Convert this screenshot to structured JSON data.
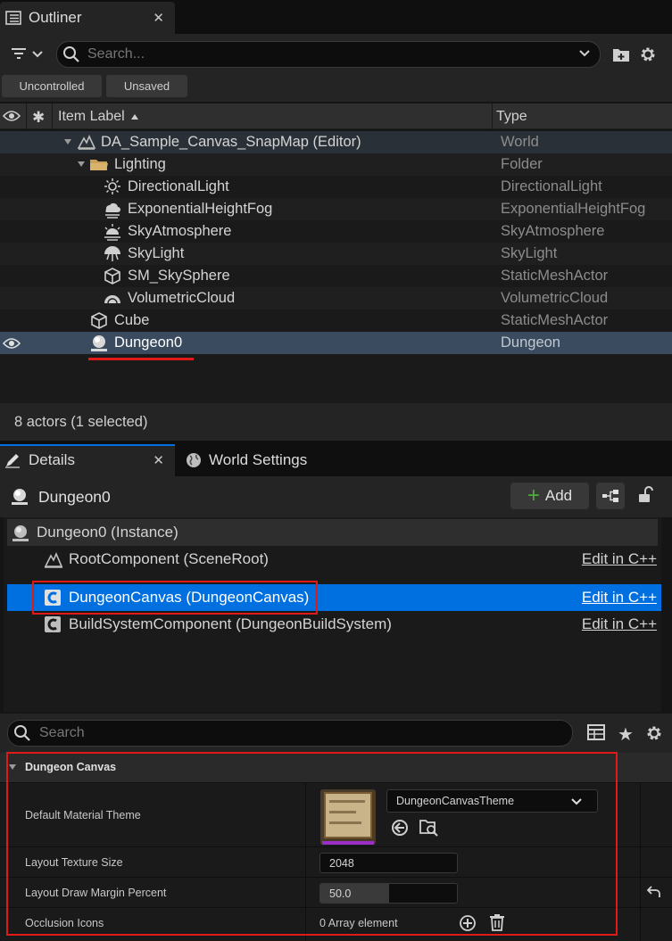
{
  "outliner": {
    "tab_title": "Outliner",
    "search_placeholder": "Search...",
    "filters": [
      "Uncontrolled",
      "Unsaved"
    ],
    "columns": {
      "label": "Item Label",
      "type": "Type"
    },
    "rows": [
      {
        "label": "DA_Sample_Canvas_SnapMap (Editor)",
        "type": "World",
        "icon": "world-icon"
      },
      {
        "label": "Lighting",
        "type": "Folder",
        "icon": "folder-icon"
      },
      {
        "label": "DirectionalLight",
        "type": "DirectionalLight",
        "icon": "sun-icon"
      },
      {
        "label": "ExponentialHeightFog",
        "type": "ExponentialHeightFog",
        "icon": "fog-icon"
      },
      {
        "label": "SkyAtmosphere",
        "type": "SkyAtmosphere",
        "icon": "atmosphere-icon"
      },
      {
        "label": "SkyLight",
        "type": "SkyLight",
        "icon": "skylight-icon"
      },
      {
        "label": "SM_SkySphere",
        "type": "StaticMeshActor",
        "icon": "static-mesh-icon"
      },
      {
        "label": "VolumetricCloud",
        "type": "VolumetricCloud",
        "icon": "cloud-icon"
      },
      {
        "label": "Cube",
        "type": "StaticMeshActor",
        "icon": "static-mesh-icon"
      },
      {
        "label": "Dungeon0",
        "type": "Dungeon",
        "icon": "dungeon-actor-icon"
      }
    ],
    "status": "8 actors (1 selected)"
  },
  "details": {
    "tab_title": "Details",
    "world_settings_tab": "World Settings",
    "actor_name": "Dungeon0",
    "add_label": "Add",
    "components": [
      {
        "label": "Dungeon0 (Instance)",
        "edit": ""
      },
      {
        "label": "RootComponent (SceneRoot)",
        "edit": "Edit in C++"
      },
      {
        "label": "DungeonCanvas (DungeonCanvas)",
        "edit": "Edit in C++"
      },
      {
        "label": "BuildSystemComponent (DungeonBuildSystem)",
        "edit": "Edit in C++"
      }
    ],
    "search_placeholder": "Search",
    "category": "Dungeon Canvas",
    "properties": {
      "material_theme_label": "Default Material Theme",
      "material_theme_value": "DungeonCanvasTheme",
      "texture_size_label": "Layout Texture Size",
      "texture_size_value": "2048",
      "margin_label": "Layout Draw Margin Percent",
      "margin_value": "50.0",
      "margin_fill": 0.5,
      "occlusion_label": "Occlusion Icons",
      "occlusion_value": "0 Array element"
    }
  },
  "colors": {
    "selection": "#0070e0",
    "highlight_box": "#e01919",
    "add_plus": "#4cae3a",
    "asset_bar": "#9b2fc8"
  }
}
